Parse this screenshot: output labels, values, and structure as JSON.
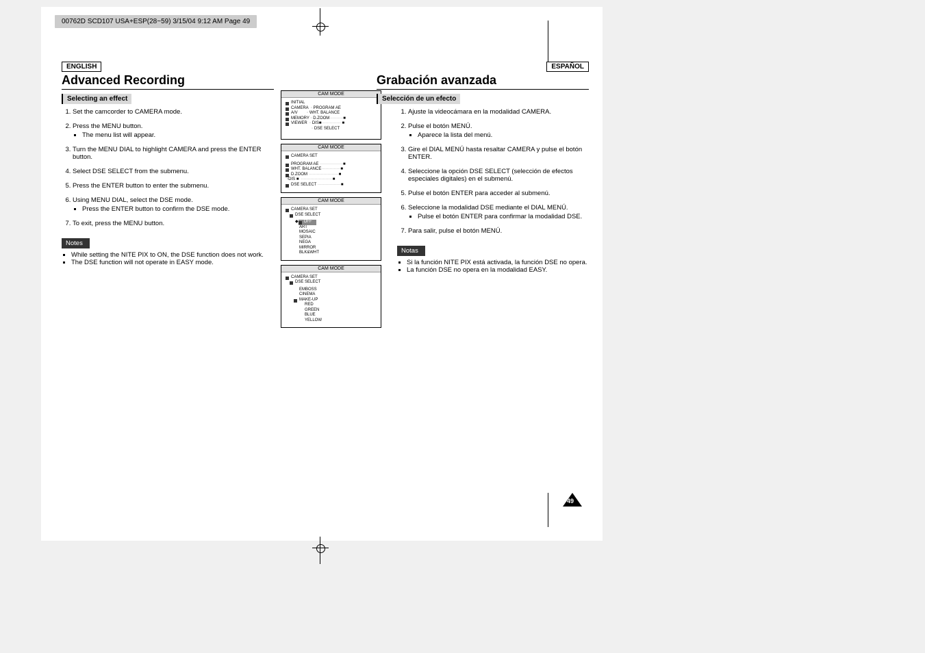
{
  "slug": "00762D SCD107 USA+ESP(28~59)  3/15/04 9:12 AM  Page 49",
  "left": {
    "lang": "ENGLISH",
    "title": "Advanced Recording",
    "subhead": "Selecting an effect",
    "step1": "Set the camcorder to CAMERA mode.",
    "step2": "Press the MENU button.",
    "step2a": "The menu list will appear.",
    "step3": "Turn the MENU DIAL to highlight CAMERA and press the ENTER button.",
    "step4": "Select DSE SELECT from the submenu.",
    "step5": "Press the ENTER button to enter the submenu.",
    "step6": "Using MENU DIAL, select the DSE mode.",
    "step6a": "Press the ENTER button to confirm the DSE mode.",
    "step7": "To exit, press the MENU button.",
    "notes_label": "Notes",
    "note1": "While setting the NITE PIX to ON, the DSE function does not work.",
    "note2": "The DSE function will not operate in EASY mode."
  },
  "right": {
    "lang": "ESPAÑOL",
    "title": "Grabación avanzada",
    "subhead": "Selección de un efecto",
    "step1": "Ajuste la videocámara en la modalidad CAMERA.",
    "step2": "Pulse el botón MENÚ.",
    "step2a": "Aparece la lista del menú.",
    "step3": "Gire el DIAL MENÚ hasta resaltar CAMERA y pulse el botón ENTER.",
    "step4": "Seleccione la opción DSE SELECT (selección de efectos especiales digitales) en el submenú.",
    "step5": "Pulse el botón ENTER para acceder al submenú.",
    "step6": "Seleccione la modalidad DSE mediante el DIAL MENÚ.",
    "step6a": "Pulse el botón ENTER para confirmar la modalidad DSE.",
    "step7": "Para salir, pulse el botón MENÚ.",
    "notes_label": "Notas",
    "note1": "Si la función NITE PIX está activada, la función DSE no opera.",
    "note2": "La función DSE no opera en la modalidad EASY."
  },
  "fig_head": "CAM MODE",
  "fig1": {
    "l1": "INITIAL",
    "l2": "CAMERA",
    "l3": "A/V",
    "l4": "MEMORY",
    "l5": "VIEWER",
    "r1": "PROGRAM AE",
    "r2": "WHT. BALANCE",
    "r3": "D.ZOOM",
    "r4": "DIS",
    "r5": "DSE SELECT"
  },
  "fig2": {
    "h": "CAMERA SET",
    "l1": "PROGRAM AE",
    "l2": "WHT. BALANCE",
    "l3": "D.ZOOM",
    "l4": "DIS",
    "l5": "DSE SELECT"
  },
  "fig3": {
    "h1": "CAMERA SET",
    "h2": "DSE SELECT",
    "o1": "OFF",
    "o2": "ART",
    "o3": "MOSAIC",
    "o4": "SEPIA",
    "o5": "NEGA",
    "o6": "MIRROR",
    "o7": "BLK&WHT"
  },
  "fig4": {
    "h1": "CAMERA SET",
    "h2": "DSE SELECT",
    "o1": "EMBOSS",
    "o2": "CINEMA",
    "o3": "MAKE-UP",
    "s1": "RED",
    "s2": "GREEN",
    "s3": "BLUE",
    "s4": "YELLOW"
  },
  "page_num": "49"
}
